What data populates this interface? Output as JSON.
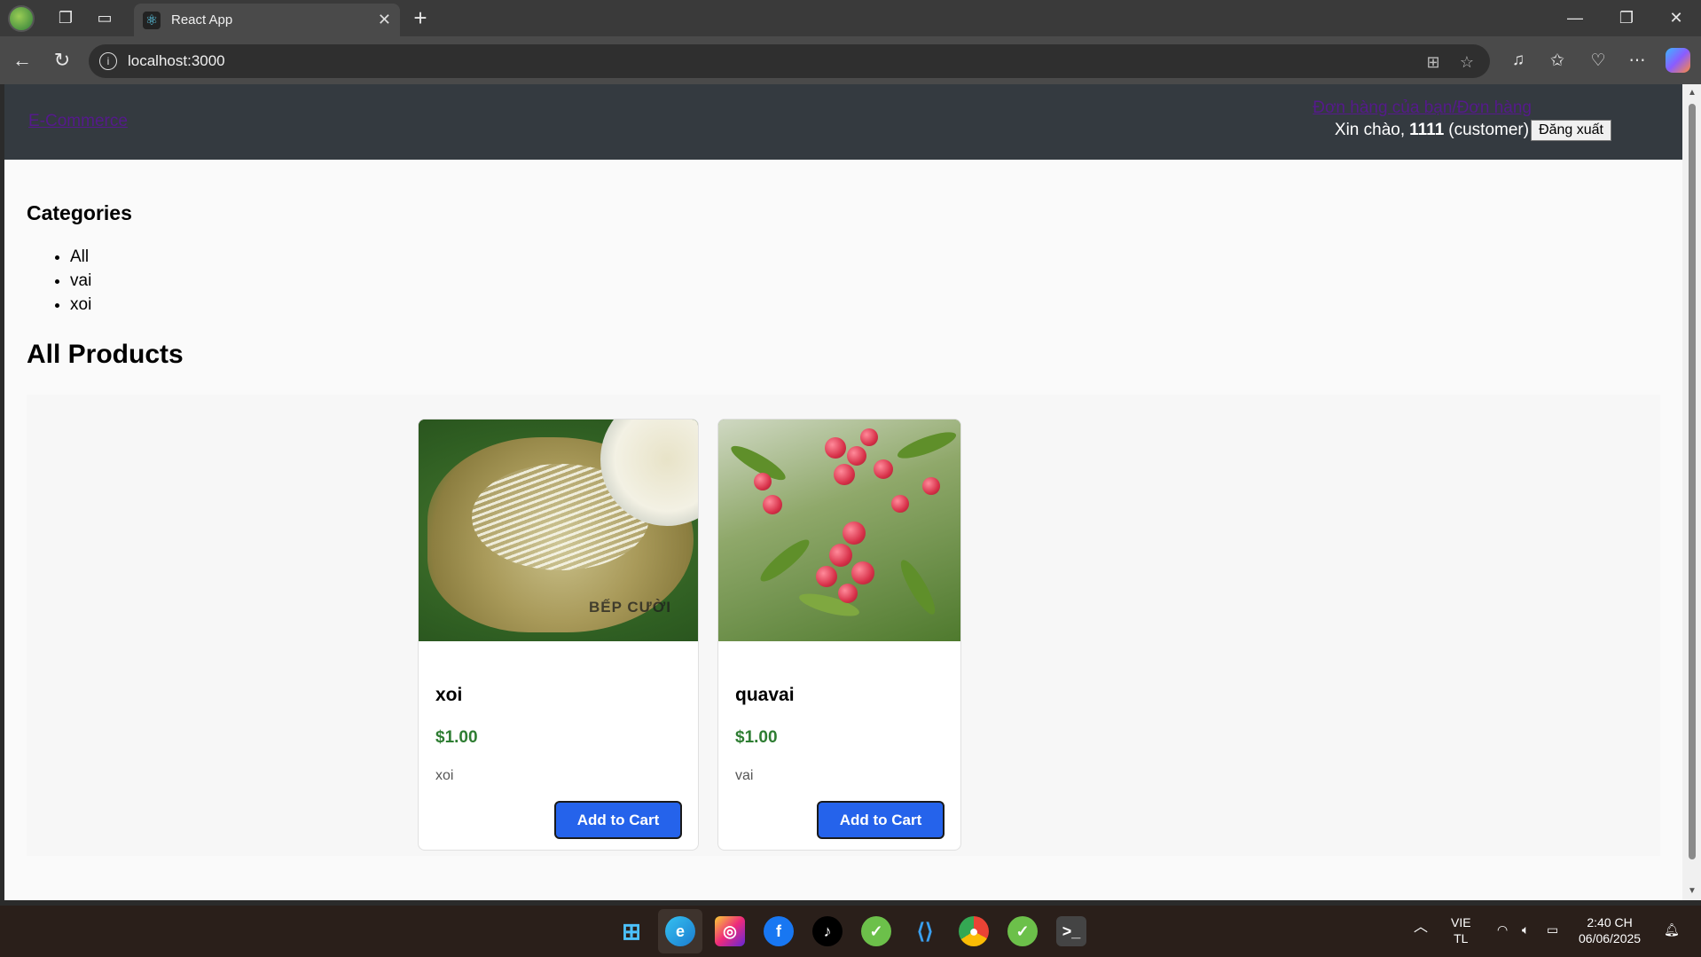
{
  "browser": {
    "tab_title": "React App",
    "url": "localhost:3000"
  },
  "header": {
    "brand": "E-Commerce",
    "orders_link": "Đơn hàng của bạn/Đơn hàng",
    "greeting_prefix": "Xin chào,",
    "username": "1111",
    "role": "(customer)",
    "logout_label": "Đăng xuất"
  },
  "categories": {
    "title": "Categories",
    "items": [
      "All",
      "vai",
      "xoi"
    ]
  },
  "products": {
    "title": "All Products",
    "items": [
      {
        "name": "xoi",
        "price": "$1.00",
        "description": "xoi",
        "button": "Add to Cart",
        "watermark": "BẾP CƯỜI"
      },
      {
        "name": "quavai",
        "price": "$1.00",
        "description": "vai",
        "button": "Add to Cart"
      }
    ]
  },
  "taskbar": {
    "lang_top": "VIE",
    "lang_bottom": "TL",
    "time": "2:40 CH",
    "date": "06/06/2025"
  },
  "colors": {
    "header_bg": "#343a40",
    "price_green": "#2e7d32",
    "button_blue": "#2563eb"
  }
}
